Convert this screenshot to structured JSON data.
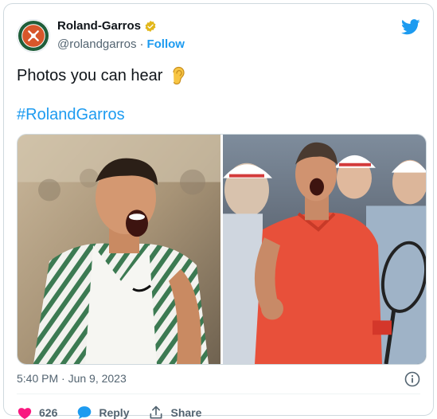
{
  "account": {
    "name": "Roland-Garros",
    "handle": "@rolandgarros",
    "separator": "·",
    "follow_label": "Follow",
    "verified_icon": "verified-badge-icon",
    "avatar_logo": "roland-garros-logo"
  },
  "tweet": {
    "text": "Photos you can hear",
    "emoji_icon": "ear-icon",
    "hashtag": "#RolandGarros",
    "timestamp": "5:40 PM · Jun 9, 2023"
  },
  "media": {
    "photos": [
      {
        "icon": "photo-player-shouting-striped-shirt"
      },
      {
        "icon": "photo-player-shouting-red-shirt"
      }
    ]
  },
  "actions": {
    "like_count": "626",
    "reply_label": "Reply",
    "share_label": "Share"
  },
  "colors": {
    "accent": "#1d9bf0",
    "like": "#f91880",
    "text_secondary": "#536471",
    "brand_orange": "#d7572b",
    "brand_green": "#1f5e3a"
  }
}
